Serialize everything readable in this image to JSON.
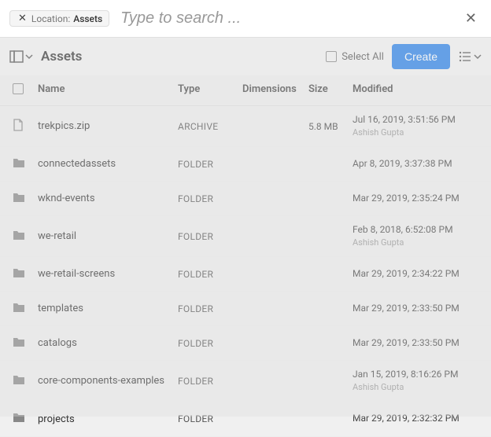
{
  "search": {
    "chip_label": "Location:",
    "chip_value": "Assets",
    "placeholder": "Type to search ..."
  },
  "toolbar": {
    "title": "Assets",
    "select_all": "Select All",
    "create": "Create"
  },
  "columns": {
    "name": "Name",
    "type": "Type",
    "dimensions": "Dimensions",
    "size": "Size",
    "modified": "Modified"
  },
  "rows": [
    {
      "icon": "file",
      "name": "trekpics.zip",
      "type": "ARCHIVE",
      "dim": "",
      "size": "5.8 MB",
      "modified": "Jul 16, 2019, 3:51:56 PM",
      "user": "Ashish Gupta"
    },
    {
      "icon": "folder",
      "name": "connectedassets",
      "type": "FOLDER",
      "dim": "",
      "size": "",
      "modified": "Apr 8, 2019, 3:37:38 PM",
      "user": ""
    },
    {
      "icon": "folder",
      "name": "wknd-events",
      "type": "FOLDER",
      "dim": "",
      "size": "",
      "modified": "Mar 29, 2019, 2:35:24 PM",
      "user": ""
    },
    {
      "icon": "folder",
      "name": "we-retail",
      "type": "FOLDER",
      "dim": "",
      "size": "",
      "modified": "Feb 8, 2018, 6:52:08 PM",
      "user": "Ashish Gupta"
    },
    {
      "icon": "folder",
      "name": "we-retail-screens",
      "type": "FOLDER",
      "dim": "",
      "size": "",
      "modified": "Mar 29, 2019, 2:34:22 PM",
      "user": ""
    },
    {
      "icon": "folder",
      "name": "templates",
      "type": "FOLDER",
      "dim": "",
      "size": "",
      "modified": "Mar 29, 2019, 2:33:50 PM",
      "user": ""
    },
    {
      "icon": "folder",
      "name": "catalogs",
      "type": "FOLDER",
      "dim": "",
      "size": "",
      "modified": "Mar 29, 2019, 2:33:50 PM",
      "user": ""
    },
    {
      "icon": "folder",
      "name": "core-components-examples",
      "type": "FOLDER",
      "dim": "",
      "size": "",
      "modified": "Jan 15, 2019, 8:16:26 PM",
      "user": "Ashish Gupta"
    },
    {
      "icon": "folder",
      "name": "projects",
      "type": "FOLDER",
      "dim": "",
      "size": "",
      "modified": "Mar 29, 2019, 2:32:32 PM",
      "user": ""
    }
  ]
}
